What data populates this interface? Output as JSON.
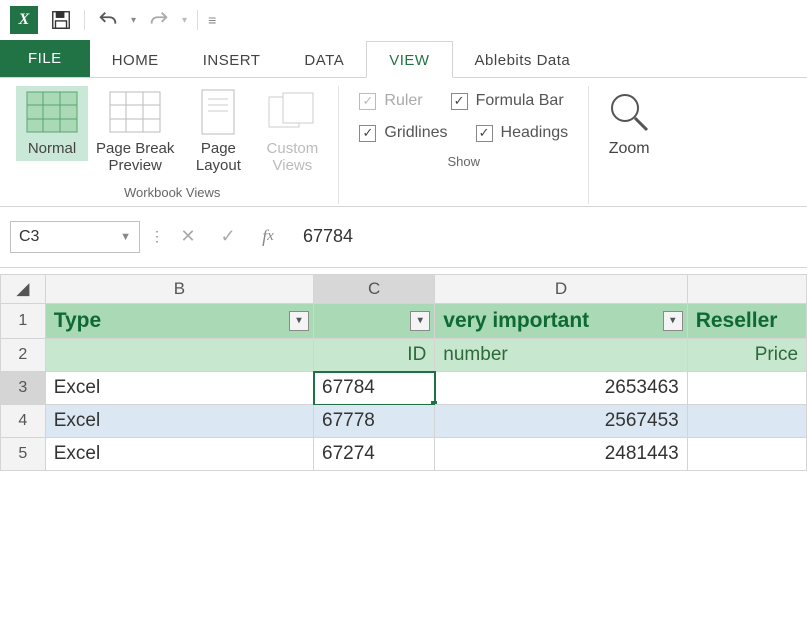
{
  "qat": {
    "tooltip_save": "Save",
    "tooltip_undo": "Undo",
    "tooltip_redo": "Redo"
  },
  "tabs": {
    "file": "FILE",
    "items": [
      "HOME",
      "INSERT",
      "DATA",
      "VIEW",
      "Ablebits Data"
    ],
    "active": "VIEW"
  },
  "ribbon": {
    "workbook_views": {
      "label": "Workbook Views",
      "normal": "Normal",
      "pagebreak": "Page Break\nPreview",
      "pagelayout": "Page\nLayout",
      "custom": "Custom\nViews"
    },
    "show": {
      "label": "Show",
      "ruler": "Ruler",
      "formula_bar": "Formula Bar",
      "gridlines": "Gridlines",
      "headings": "Headings"
    },
    "zoom": "Zoom"
  },
  "formula_bar": {
    "name_box": "C3",
    "value": "67784"
  },
  "grid": {
    "columns": [
      "B",
      "C",
      "D"
    ],
    "header1": {
      "b": "Type",
      "c": "",
      "d": "very important",
      "e": "Reseller"
    },
    "header2": {
      "b": "",
      "c": "ID",
      "d": "number",
      "e": "Price"
    },
    "rows": [
      {
        "n": "3",
        "b": "Excel",
        "c": "67784",
        "d": "2653463"
      },
      {
        "n": "4",
        "b": "Excel",
        "c": "67778",
        "d": "2567453"
      },
      {
        "n": "5",
        "b": "Excel",
        "c": "67274",
        "d": "2481443"
      }
    ]
  }
}
